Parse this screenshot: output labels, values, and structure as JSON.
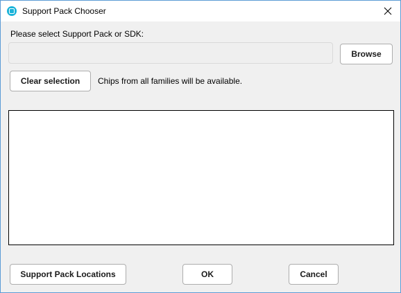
{
  "window": {
    "title": "Support Pack Chooser",
    "icon": "app-icon",
    "close_icon": "close-icon"
  },
  "selection": {
    "prompt": "Please select Support Pack or SDK:",
    "path_value": "",
    "browse_label": "Browse",
    "clear_label": "Clear selection",
    "info_text": "Chips from all families will be available."
  },
  "list": {
    "items": []
  },
  "footer": {
    "locations_label": "Support Pack Locations",
    "ok_label": "OK",
    "cancel_label": "Cancel"
  },
  "colors": {
    "window_border": "#5b9bd5",
    "icon_accent": "#1ab3d9",
    "background": "#f0f0f0"
  }
}
